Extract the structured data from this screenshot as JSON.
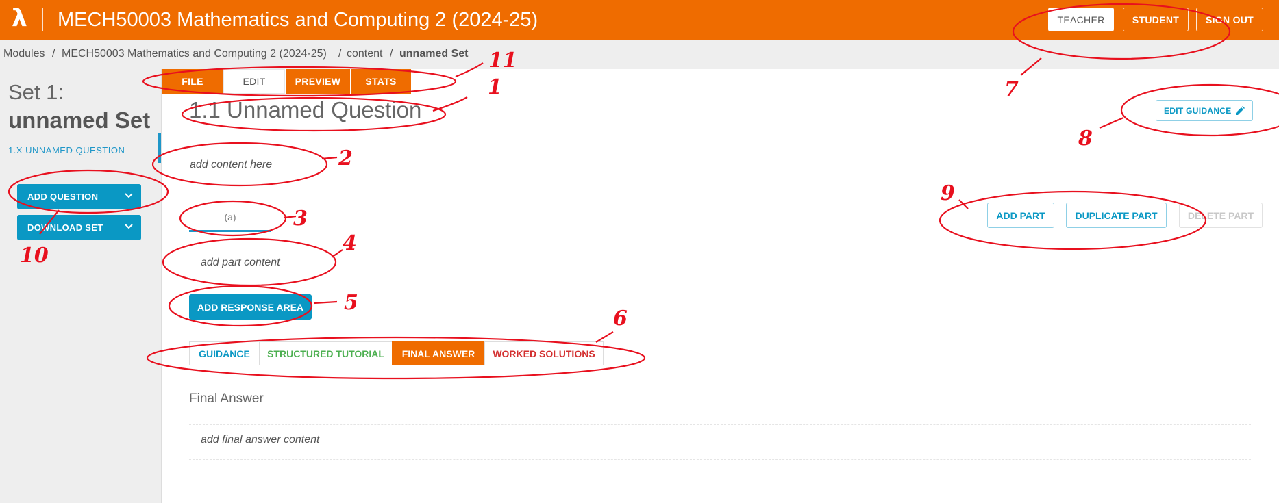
{
  "header": {
    "logo": "λ",
    "title": "MECH50003 Mathematics and Computing 2 (2024-25)",
    "buttons": {
      "teacher": "TEACHER",
      "student": "STUDENT",
      "signout": "SIGN OUT"
    }
  },
  "breadcrumb": {
    "modules": "Modules",
    "sep": "/",
    "module": "MECH50003 Mathematics and Computing 2 (2024-25)",
    "content": "content",
    "current": "unnamed Set"
  },
  "sidebar": {
    "set_label": "Set 1:",
    "set_name": "unnamed Set",
    "question_link": "1.X UNNAMED QUESTION",
    "add_question": "ADD QUESTION",
    "download_set": "DOWNLOAD SET"
  },
  "tabs": {
    "file": "FILE",
    "edit": "EDIT",
    "preview": "PREVIEW",
    "stats": "STATS"
  },
  "question": {
    "title": "1.1 Unnamed Question",
    "edit_guidance": "EDIT GUIDANCE",
    "content_placeholder": "add content here"
  },
  "part": {
    "tab_label": "(a)",
    "add_part": "ADD PART",
    "duplicate_part": "DUPLICATE PART",
    "delete_part": "DELETE PART",
    "content_placeholder": "add part content",
    "add_response_area": "ADD RESPONSE AREA"
  },
  "guidance_tabs": {
    "guidance": "GUIDANCE",
    "structured_tutorial": "STRUCTURED TUTORIAL",
    "final_answer": "FINAL ANSWER",
    "worked_solutions": "WORKED SOLUTIONS"
  },
  "final_answer": {
    "heading": "Final Answer",
    "placeholder": "add final answer content"
  },
  "annotations": [
    "1",
    "2",
    "3",
    "4",
    "5",
    "6",
    "7",
    "8",
    "9",
    "10",
    "11"
  ],
  "colors": {
    "brand_orange": "#ef6c00",
    "accent_blue": "#0a98c4",
    "tutorial_green": "#4caf50",
    "solutions_red": "#d32f2f",
    "annotation_red": "#e8101e"
  }
}
